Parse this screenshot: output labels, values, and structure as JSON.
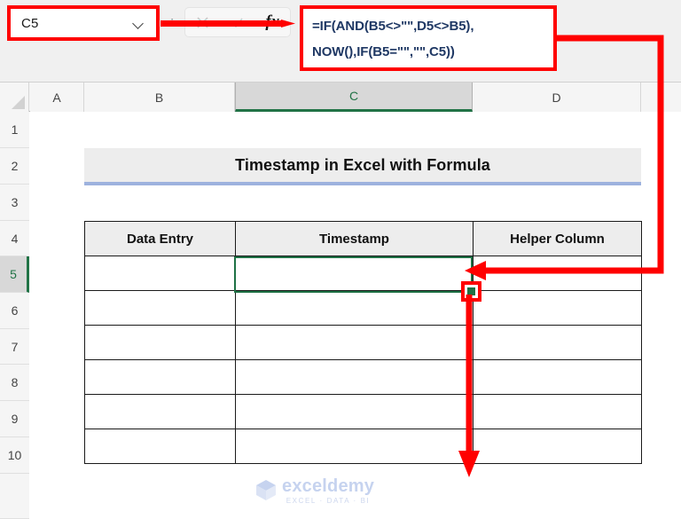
{
  "formula_bar": {
    "name_box": {
      "value": "C5",
      "dropdown_icon": "chevron-down-icon"
    },
    "separator": ":",
    "icons": [
      {
        "name": "cancel-icon",
        "glyph": "✕",
        "enabled": false
      },
      {
        "name": "enter-icon",
        "glyph": "✓",
        "enabled": false
      },
      {
        "name": "insert-function-icon",
        "glyph": "fx",
        "enabled": true
      }
    ],
    "formula_lines": [
      "=IF(AND(B5<>\"\",D5<>B5),",
      "NOW(),IF(B5=\"\",\"\",C5))"
    ],
    "formula_full": "=IF(AND(B5<>\"\",D5<>B5),NOW(),IF(B5=\"\",\"\",C5))"
  },
  "grid": {
    "column_headers": [
      "A",
      "B",
      "C",
      "D"
    ],
    "selected_column": "C",
    "row_headers": [
      "1",
      "2",
      "3",
      "4",
      "5",
      "6",
      "7",
      "8",
      "9",
      "10"
    ],
    "selected_row": "5",
    "active_cell": "C5"
  },
  "sheet": {
    "title": "Timestamp in Excel with Formula",
    "table": {
      "headers": [
        "Data Entry",
        "Timestamp",
        "Helper Column"
      ],
      "rows": [
        [
          "",
          "",
          ""
        ],
        [
          "",
          "",
          ""
        ],
        [
          "",
          "",
          ""
        ],
        [
          "",
          "",
          ""
        ],
        [
          "",
          "",
          ""
        ],
        [
          "",
          "",
          ""
        ]
      ]
    }
  },
  "annotations": {
    "color": "#ff0000",
    "name_box_highlight": "name-box-outline",
    "formula_highlight": "formula-box-outline",
    "fill_handle_highlight": "fill-handle-outline",
    "arrow_to_formula": "arrow-name-box-to-formula",
    "arrow_to_cell": "arrow-formula-to-cell",
    "arrow_fill_down": "arrow-fill-handle-down"
  },
  "watermark": {
    "name": "exceldemy",
    "tagline": "EXCEL · DATA · BI",
    "logo": "exceldemy-cube-logo"
  }
}
